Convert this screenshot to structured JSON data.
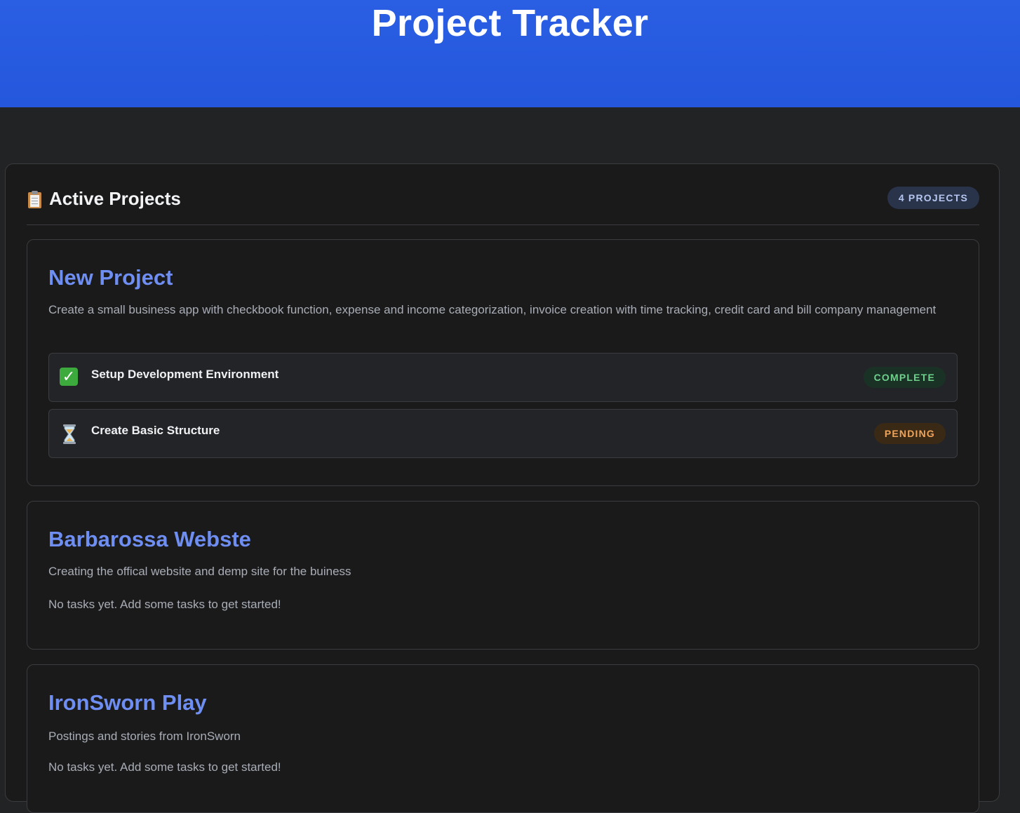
{
  "header": {
    "title": "Project Tracker"
  },
  "panel": {
    "icon": "clipboard-icon",
    "title": "Active Projects",
    "count_label": "4 PROJECTS"
  },
  "projects": [
    {
      "name": "New Project",
      "description": "Create a small business app with checkbook function, expense and income categorization, invoice creation with time tracking, credit card and bill company management",
      "tasks": [
        {
          "icon": "check-mark-icon",
          "label": "Setup Development Environment",
          "status": "COMPLETE"
        },
        {
          "icon": "hourglass-icon",
          "label": "Create Basic Structure",
          "status": "PENDING"
        }
      ]
    },
    {
      "name": "Barbarossa Webste",
      "description": "Creating the offical website and demp site for the buiness",
      "empty_note": "No tasks yet. Add some tasks to get started!"
    },
    {
      "name": "IronSworn Play",
      "description": "Postings and stories from IronSworn",
      "empty_note": "No tasks yet. Add some tasks to get started!"
    }
  ],
  "colors": {
    "header_blue": "#2a5ee3",
    "project_name": "#6f8ef2",
    "complete": "#6fd08c",
    "pending": "#f0a35a"
  }
}
